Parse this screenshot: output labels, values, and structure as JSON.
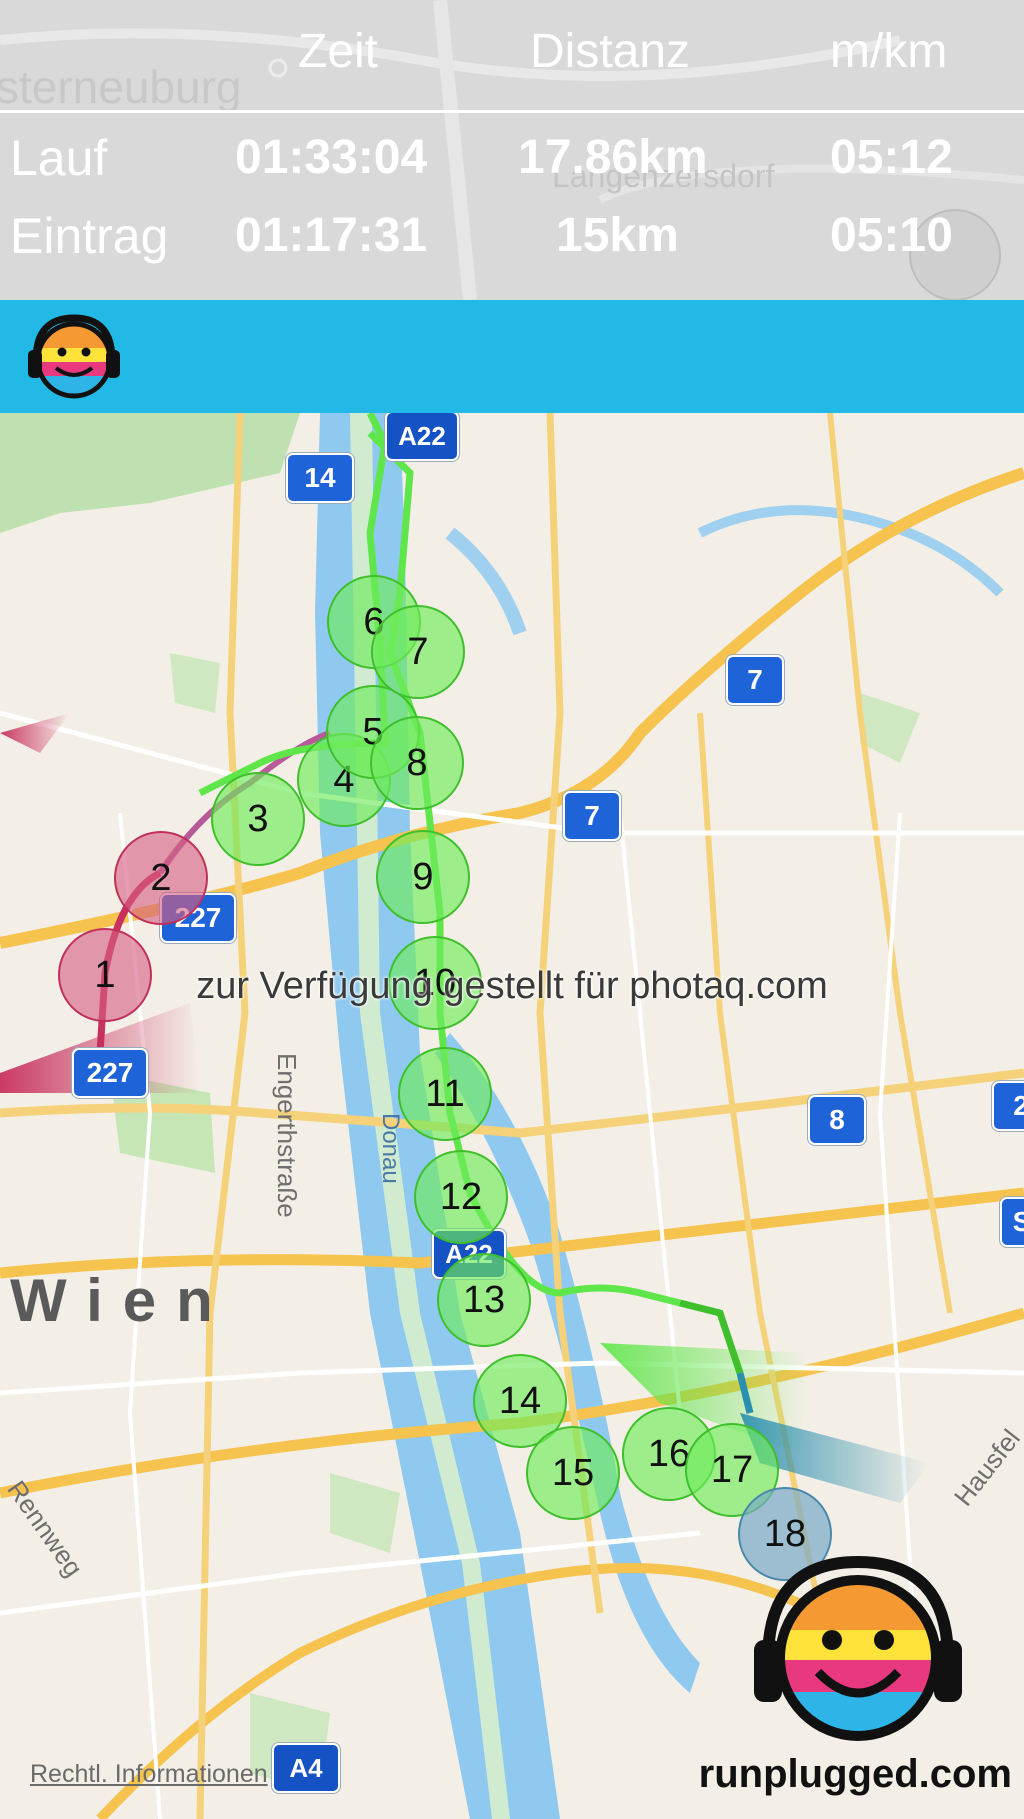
{
  "stats": {
    "headers": {
      "time": "Zeit",
      "distance": "Distanz",
      "pace": "m/km"
    },
    "rows": [
      {
        "label": "Lauf",
        "time": "01:33:04",
        "distance": "17.86km",
        "pace": "05:12"
      },
      {
        "label": "Eintrag",
        "time": "01:17:31",
        "distance": "15km",
        "pace": "05:10"
      }
    ],
    "background_map_labels": {
      "town1": "sterneuburg",
      "town2": "Langenzersdorf"
    }
  },
  "header_bar": {
    "color": "#23b9e6",
    "logo_icon": "headphone-smiley-icon"
  },
  "map": {
    "road_shields": [
      {
        "text": "A22"
      },
      {
        "text": "14"
      },
      {
        "text": "7"
      },
      {
        "text": "7"
      },
      {
        "text": "227"
      },
      {
        "text": "227"
      },
      {
        "text": "8"
      },
      {
        "text": "2"
      },
      {
        "text": "A22"
      },
      {
        "text": "S"
      },
      {
        "text": "A4"
      }
    ],
    "street_labels": {
      "engerthstrasse": "Engerthstraße",
      "donau": "Donau",
      "wien": "Wien",
      "rennweg": "Rennweg",
      "hausfeld": "Hausfel"
    },
    "km_markers": [
      "1",
      "2",
      "3",
      "4",
      "5",
      "6",
      "7",
      "8",
      "9",
      "10",
      "11",
      "12",
      "13",
      "14",
      "15",
      "16",
      "17",
      "18"
    ],
    "marker_colors": {
      "red": "#d66082",
      "green": "#6eeb5a",
      "blue": "#78aac8"
    },
    "route_colors": {
      "start": "#c8305e",
      "main": "#5ee64a",
      "end": "#2b8fb0"
    },
    "watermark": "zur Verfügung gestellt für photaq.com",
    "legal_link": "Rechtl. Informationen",
    "brand": "runplugged.com",
    "brand_icon": "headphone-smiley-icon"
  }
}
